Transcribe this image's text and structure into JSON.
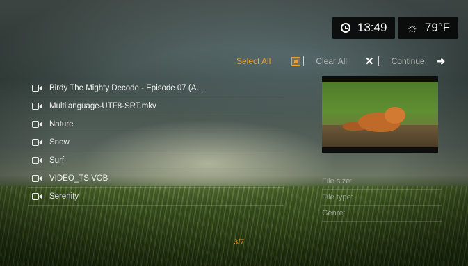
{
  "status": {
    "time": "13:49",
    "weather_temp": "79°F",
    "weather_icon": "sun-icon"
  },
  "actions": {
    "select_all": "Select All",
    "clear_all": "Clear All",
    "continue": "Continue"
  },
  "files": [
    {
      "name": "Birdy The Mighty Decode - Episode 07 (A...",
      "icon": "video-camera-icon"
    },
    {
      "name": "Multilanguage-UTF8-SRT.mkv",
      "icon": "video-camera-icon"
    },
    {
      "name": "Nature",
      "icon": "video-camera-icon"
    },
    {
      "name": "Snow",
      "icon": "video-camera-icon"
    },
    {
      "name": "Surf",
      "icon": "video-camera-icon"
    },
    {
      "name": "VIDEO_TS.VOB",
      "icon": "video-camera-icon"
    },
    {
      "name": "Serenity",
      "icon": "video-camera-icon"
    }
  ],
  "details": {
    "file_size": "File size:",
    "file_type": "File type:",
    "genre": "Genre:"
  },
  "pager": "3/7",
  "colors": {
    "accent": "#e8a030",
    "panel": "#000000"
  }
}
